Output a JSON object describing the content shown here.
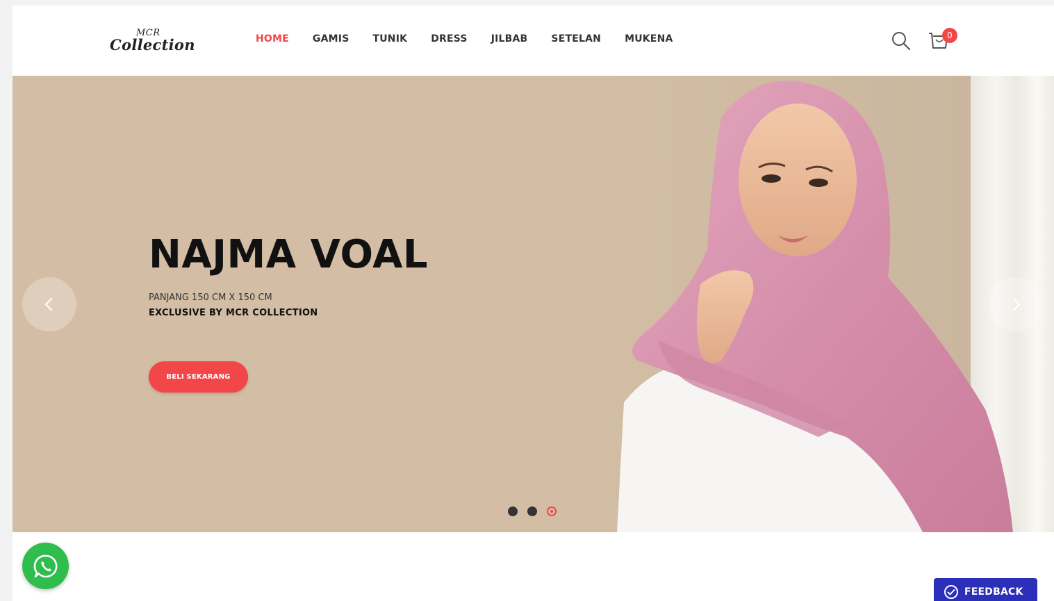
{
  "brand": {
    "logo_top": "MCR",
    "logo_bottom": "Collection"
  },
  "nav": {
    "items": [
      {
        "label": "HOME",
        "active": true
      },
      {
        "label": "GAMIS",
        "active": false
      },
      {
        "label": "TUNIK",
        "active": false
      },
      {
        "label": "DRESS",
        "active": false
      },
      {
        "label": "JILBAB",
        "active": false
      },
      {
        "label": "SETELAN",
        "active": false
      },
      {
        "label": "MUKENA",
        "active": false
      }
    ]
  },
  "header": {
    "search_icon": "search-icon",
    "cart_icon": "cart-icon",
    "cart_count": "0"
  },
  "hero": {
    "title": "NAJMA VOAL",
    "subtitle_line1": "PANJANG 150 CM X 150 CM",
    "subtitle_line2": "EXCLUSIVE BY MCR COLLECTION",
    "cta_label": "BELI SEKARANG",
    "slide_count": 3,
    "active_slide": 3
  },
  "floating": {
    "whatsapp_icon": "whatsapp-icon",
    "feedback_label": "FEEDBACK"
  },
  "colors": {
    "accent": "#f24649",
    "hero_bg": "#d3bea5",
    "whatsapp": "#2fbd4e",
    "feedback": "#2b2fb9"
  }
}
